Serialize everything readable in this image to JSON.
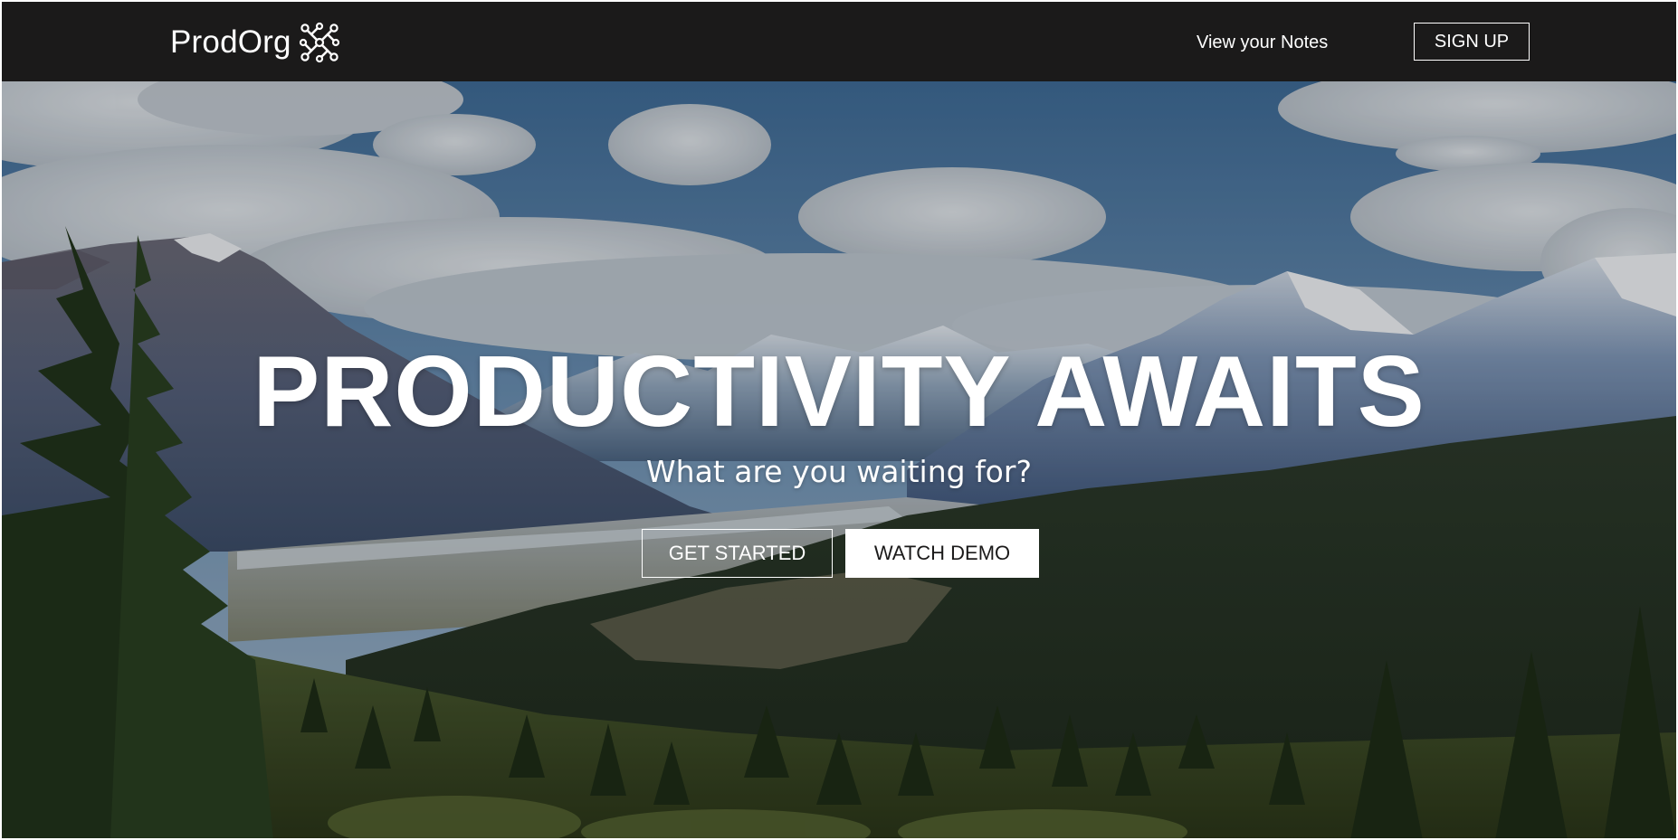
{
  "navbar": {
    "brand_name": "ProdOrg",
    "brand_icon": "network-node-icon",
    "notes_link": "View your Notes",
    "signup_label": "SIGN UP",
    "background_color": "#1b1a1a"
  },
  "hero": {
    "title": "PRODUCTIVITY AWAITS",
    "subtitle": "What are you waiting for?",
    "get_started_label": "GET STARTED",
    "watch_demo_label": "WATCH DEMO",
    "background_image": "mountain-forest-landscape"
  }
}
